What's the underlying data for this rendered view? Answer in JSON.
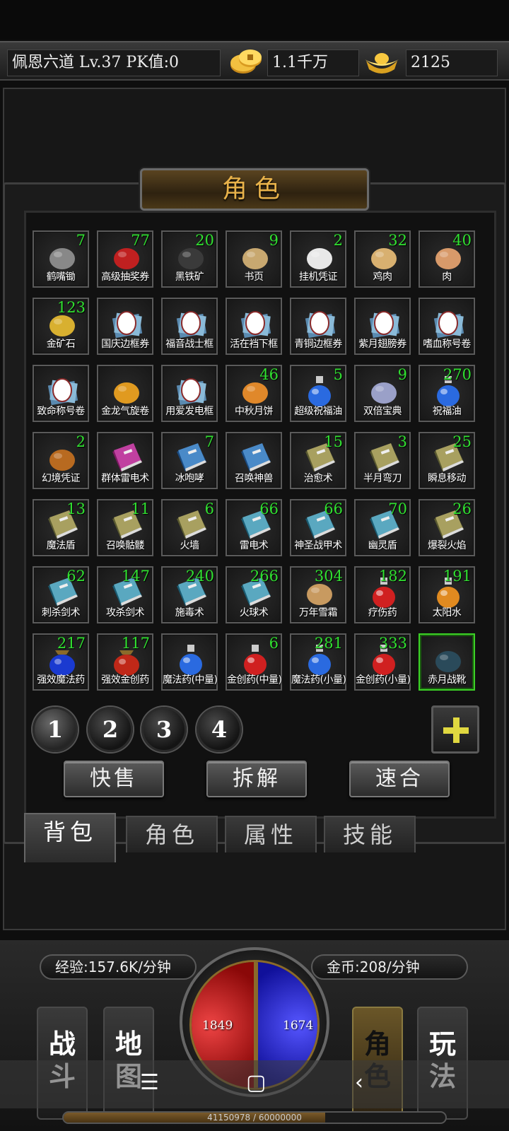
{
  "topbar": {
    "player_info": "佩恩六道  Lv.37 PK值:0",
    "gold": "1.1千万",
    "ingots": "2125"
  },
  "panel_title": "角色",
  "items": [
    {
      "name": "鹤嘴锄",
      "count": "7",
      "icon": "pickaxe-icon"
    },
    {
      "name": "高级抽奖券",
      "count": "77",
      "icon": "lottery-ticket-icon"
    },
    {
      "name": "黑铁矿",
      "count": "20",
      "icon": "black-iron-ore-icon"
    },
    {
      "name": "书页",
      "count": "9",
      "icon": "book-page-icon"
    },
    {
      "name": "挂机凭证",
      "count": "2",
      "icon": "idle-voucher-icon"
    },
    {
      "name": "鸡肉",
      "count": "32",
      "icon": "chicken-icon"
    },
    {
      "name": "肉",
      "count": "40",
      "icon": "meat-icon"
    },
    {
      "name": "金矿石",
      "count": "123",
      "icon": "gold-ore-icon"
    },
    {
      "name": "国庆边框券",
      "count": "",
      "icon": "frame-voucher-icon"
    },
    {
      "name": "福音战士框",
      "count": "",
      "icon": "frame-voucher-icon"
    },
    {
      "name": "活在裆下框",
      "count": "",
      "icon": "frame-voucher-icon"
    },
    {
      "name": "青铜边框券",
      "count": "",
      "icon": "frame-voucher-icon"
    },
    {
      "name": "紫月翅膀券",
      "count": "",
      "icon": "wing-voucher-icon"
    },
    {
      "name": "嗜血称号卷",
      "count": "",
      "icon": "title-scroll-icon"
    },
    {
      "name": "致命称号卷",
      "count": "",
      "icon": "title-scroll-icon"
    },
    {
      "name": "金龙气旋卷",
      "count": "",
      "icon": "golden-dragon-icon"
    },
    {
      "name": "用爱发电框",
      "count": "",
      "icon": "frame-voucher-icon"
    },
    {
      "name": "中秋月饼",
      "count": "46",
      "icon": "mooncake-icon"
    },
    {
      "name": "超级祝福油",
      "count": "5",
      "icon": "blue-potion-icon"
    },
    {
      "name": "双倍宝典",
      "count": "9",
      "icon": "double-book-icon"
    },
    {
      "name": "祝福油",
      "count": "270",
      "icon": "blue-potion-icon"
    },
    {
      "name": "幻境凭证",
      "count": "2",
      "icon": "mystery-token-icon"
    },
    {
      "name": "群体雷电术",
      "count": "",
      "icon": "pink-book-icon"
    },
    {
      "name": "冰咆哮",
      "count": "7",
      "icon": "blue-book-icon"
    },
    {
      "name": "召唤神兽",
      "count": "",
      "icon": "blue-book-icon"
    },
    {
      "name": "治愈术",
      "count": "15",
      "icon": "olive-book-icon"
    },
    {
      "name": "半月弯刀",
      "count": "3",
      "icon": "olive-book-icon"
    },
    {
      "name": "瞬息移动",
      "count": "25",
      "icon": "olive-book-icon"
    },
    {
      "name": "魔法盾",
      "count": "13",
      "icon": "olive-book-icon"
    },
    {
      "name": "召唤骷髅",
      "count": "11",
      "icon": "olive-book-icon"
    },
    {
      "name": "火墙",
      "count": "6",
      "icon": "olive-book-icon"
    },
    {
      "name": "雷电术",
      "count": "66",
      "icon": "teal-book-icon"
    },
    {
      "name": "神圣战甲术",
      "count": "66",
      "icon": "teal-book-icon"
    },
    {
      "name": "幽灵盾",
      "count": "70",
      "icon": "teal-book-icon"
    },
    {
      "name": "爆裂火焰",
      "count": "26",
      "icon": "olive-book-icon"
    },
    {
      "name": "刺杀剑术",
      "count": "62",
      "icon": "teal-book-icon"
    },
    {
      "name": "攻杀剑术",
      "count": "147",
      "icon": "teal-book-icon"
    },
    {
      "name": "施毒术",
      "count": "240",
      "icon": "teal-book-icon"
    },
    {
      "name": "火球术",
      "count": "266",
      "icon": "teal-book-icon"
    },
    {
      "name": "万年雪霜",
      "count": "304",
      "icon": "ginseng-icon"
    },
    {
      "name": "疗伤药",
      "count": "182",
      "icon": "red-potion-icon"
    },
    {
      "name": "太阳水",
      "count": "191",
      "icon": "orange-potion-icon"
    },
    {
      "name": "强效魔法药",
      "count": "217",
      "icon": "blue-bag-icon"
    },
    {
      "name": "强效金创药",
      "count": "117",
      "icon": "red-bag-icon"
    },
    {
      "name": "魔法药(中量)",
      "count": "",
      "icon": "blue-potion-icon"
    },
    {
      "name": "金创药(中量)",
      "count": "6",
      "icon": "red-potion-icon"
    },
    {
      "name": "魔法药(小量)",
      "count": "281",
      "icon": "blue-potion-icon"
    },
    {
      "name": "金创药(小量)",
      "count": "333",
      "icon": "red-potion-icon"
    },
    {
      "name": "赤月战靴",
      "count": "",
      "icon": "boots-icon"
    }
  ],
  "pages": [
    "1",
    "2",
    "3",
    "4"
  ],
  "actions": {
    "quick_sell": "快售",
    "dismantle": "拆解",
    "fast_merge": "速合"
  },
  "tabs": [
    "背包",
    "角色",
    "属性",
    "技能"
  ],
  "rates": {
    "exp": "经验:157.6K/分钟",
    "gold": "金币:208/分钟"
  },
  "orb": {
    "hp": "1849",
    "mp": "1674"
  },
  "nav": {
    "battle": "战\n斗",
    "map": "地\n图",
    "character": "角\n色",
    "play": "玩\n法"
  },
  "xp": {
    "text": "41150978 / 60000000",
    "fraction": 0.686
  },
  "colors": {
    "count_green": "#30e030",
    "title_gold": "#e8b24a",
    "selected_border": "#3cd226"
  }
}
